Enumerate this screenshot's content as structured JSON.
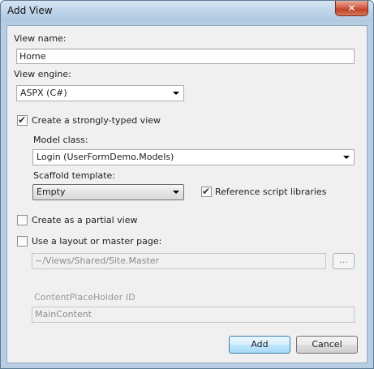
{
  "window": {
    "title": "Add View",
    "close_symbol": "✕"
  },
  "view_name": {
    "label": "View name:",
    "value": "Home"
  },
  "view_engine": {
    "label": "View engine:",
    "selected": "ASPX (C#)"
  },
  "strongly_typed": {
    "label": "Create a strongly-typed view",
    "checked": true
  },
  "model_class": {
    "label": "Model class:",
    "selected": "Login (UserFormDemo.Models)"
  },
  "scaffold": {
    "label": "Scaffold template:",
    "selected": "Empty"
  },
  "reference_scripts": {
    "label": "Reference script libraries",
    "checked": true
  },
  "partial_view": {
    "label": "Create as a partial view",
    "checked": false
  },
  "layout": {
    "label": "Use a layout or master page:",
    "checked": false,
    "value": "~/Views/Shared/Site.Master",
    "browse_label": "..."
  },
  "content_placeholder": {
    "label": "ContentPlaceHolder ID",
    "value": "MainContent"
  },
  "buttons": {
    "add": "Add",
    "cancel": "Cancel"
  },
  "check_glyph": "✔"
}
